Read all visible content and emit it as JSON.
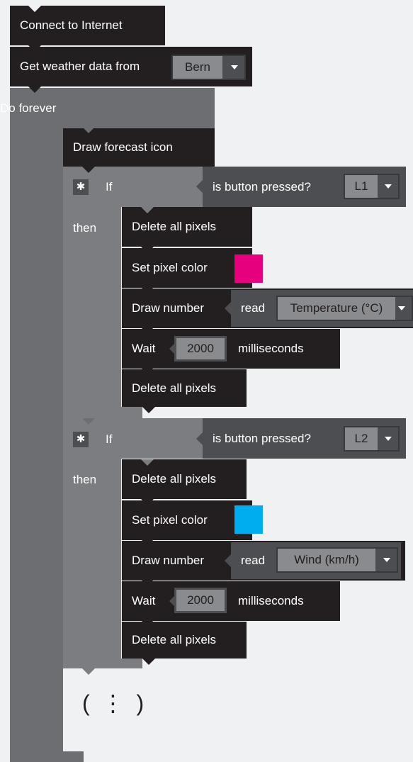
{
  "blocks": {
    "connect": "Connect to Internet",
    "weather": {
      "label": "Get weather data from",
      "city": "Bern"
    },
    "forever": "Do forever",
    "forecast": "Draw forecast icon",
    "if_label": "If",
    "then_label": "then",
    "cond_text": "is button pressed?",
    "delete": "Delete all pixels",
    "set_color": "Set pixel color",
    "draw_number": "Draw number",
    "read": "read",
    "wait": "Wait",
    "ms": "milliseconds"
  },
  "if1": {
    "button": "L1",
    "color": "#e6007e",
    "sensor": "Temperature (°C)",
    "wait_ms": "2000"
  },
  "if2": {
    "button": "L2",
    "color": "#00aeef",
    "sensor": "Wind (km/h)",
    "wait_ms": "2000"
  },
  "more": "( ⋮ )",
  "icons": {
    "gear": "gear-icon",
    "dropdown": "triangle-down-icon"
  }
}
